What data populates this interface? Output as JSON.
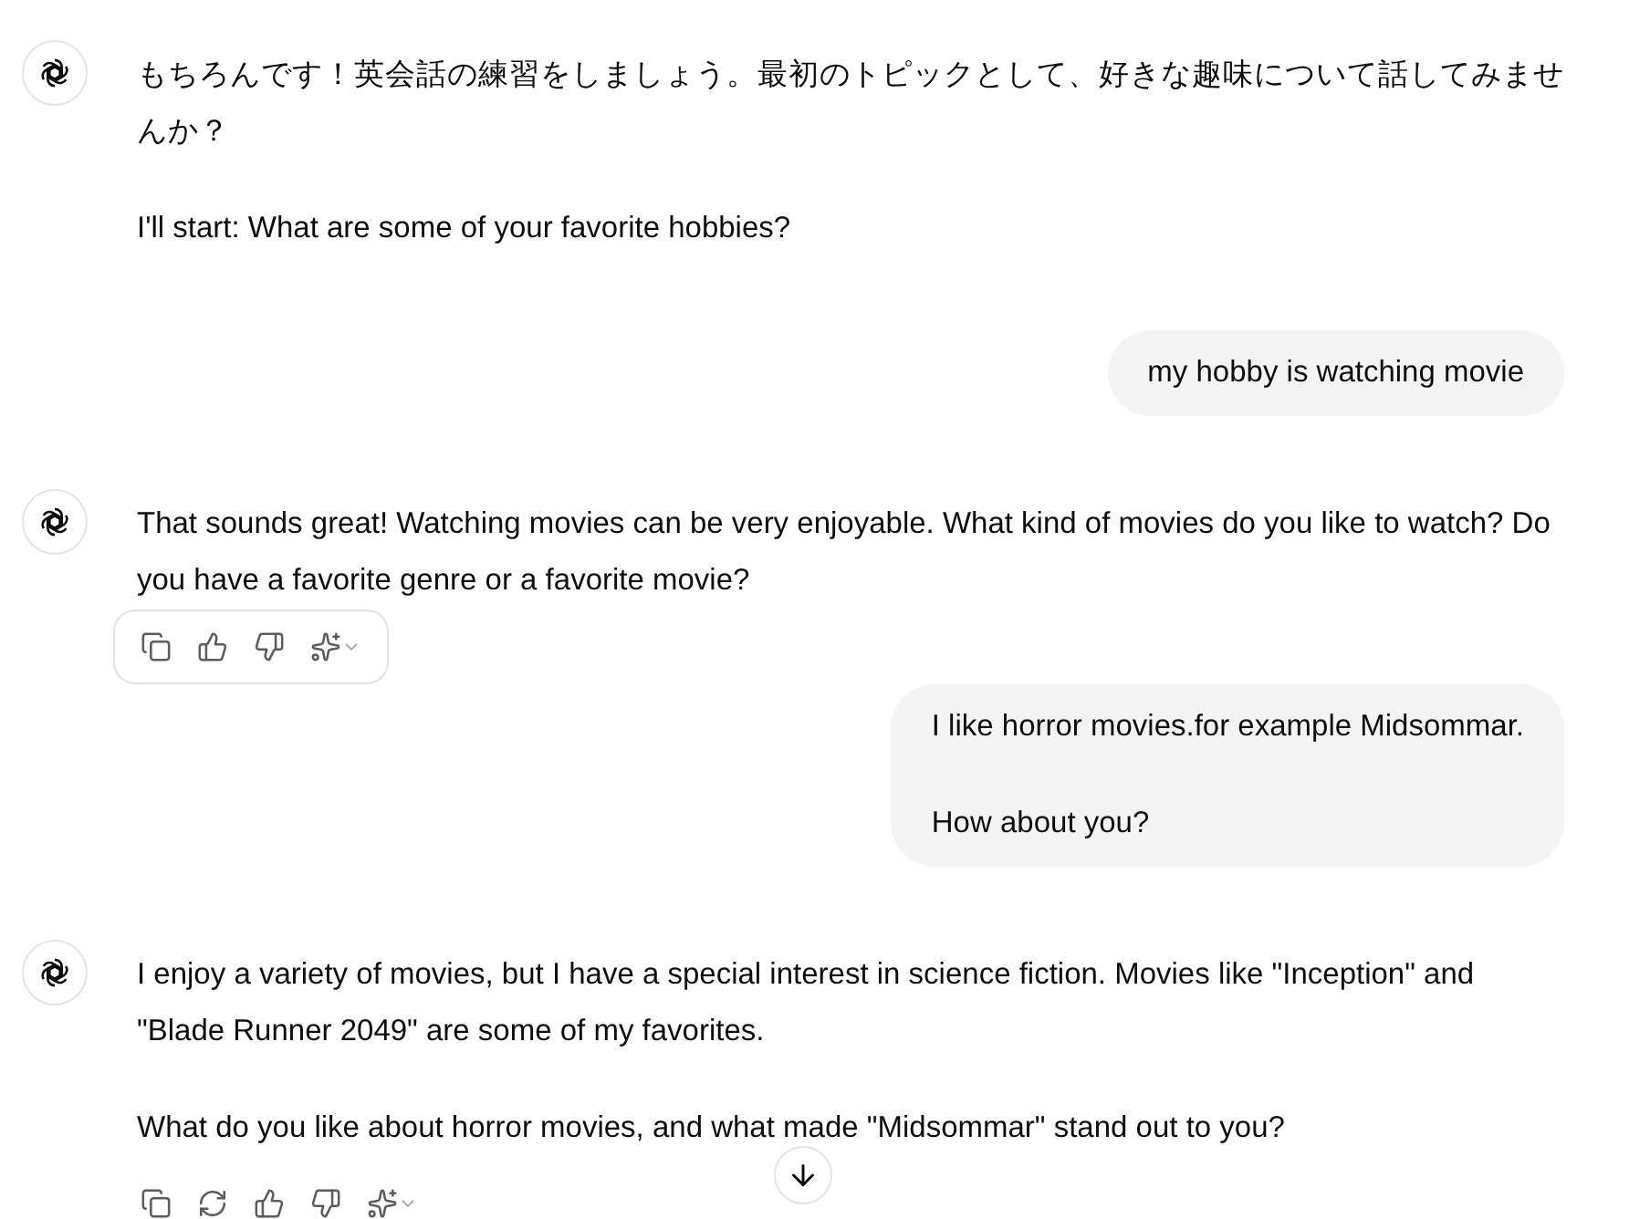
{
  "messages": [
    {
      "kind": "assistant",
      "paragraphs": [
        "もちろんです！英会話の練習をしましょう。最初のトピックとして、好きな趣味について話してみませんか？",
        "I'll start: What are some of your favorite hobbies?"
      ]
    },
    {
      "kind": "user",
      "paragraphs": [
        "my hobby is watching movie"
      ]
    },
    {
      "kind": "assistant",
      "paragraphs": [
        "That sounds great! Watching movies can be very enjoyable. What kind of movies do you like to watch? Do you have a favorite genre or a favorite movie?"
      ],
      "toolbar": {
        "kind": "hover"
      }
    },
    {
      "kind": "user",
      "paragraphs": [
        "I like horror movies.for example Midsommar.",
        "How about you?"
      ]
    },
    {
      "kind": "assistant",
      "paragraphs": [
        "I enjoy a variety of movies, but I have a special interest in science fiction. Movies like \"Inception\" and \"Blade Runner 2049\" are some of my favorites.",
        "What do you like about horror movies, and what made \"Midsommar\" stand out to you?"
      ],
      "toolbar": {
        "kind": "latest"
      }
    }
  ]
}
